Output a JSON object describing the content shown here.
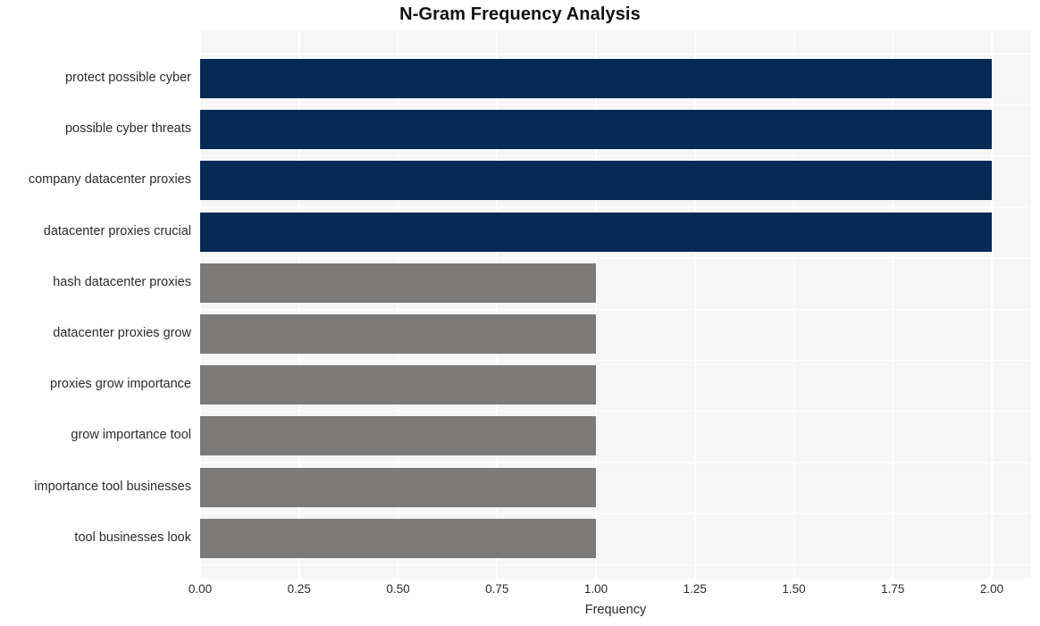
{
  "chart_data": {
    "type": "bar",
    "orientation": "horizontal",
    "title": "N-Gram Frequency Analysis",
    "xlabel": "Frequency",
    "ylabel": "",
    "xlim": [
      0.0,
      2.0
    ],
    "grid": true,
    "legend": null,
    "xticks": [
      "0.00",
      "0.25",
      "0.50",
      "0.75",
      "1.00",
      "1.25",
      "1.50",
      "1.75",
      "2.00"
    ],
    "xtick_values": [
      0.0,
      0.25,
      0.5,
      0.75,
      1.0,
      1.25,
      1.5,
      1.75,
      2.0
    ],
    "categories": [
      "protect possible cyber",
      "possible cyber threats",
      "company datacenter proxies",
      "datacenter proxies crucial",
      "hash datacenter proxies",
      "datacenter proxies grow",
      "proxies grow importance",
      "grow importance tool",
      "importance tool businesses",
      "tool businesses look"
    ],
    "values": [
      2,
      2,
      2,
      2,
      1,
      1,
      1,
      1,
      1,
      1
    ],
    "bar_colors": [
      "#042a55",
      "#042a55",
      "#042a55",
      "#042a55",
      "#7b7a78",
      "#7b7a78",
      "#7b7a78",
      "#7b7a78",
      "#7b7a78",
      "#7b7a78"
    ]
  },
  "colors": {
    "highlight": "#042a55",
    "normal": "#7b7a78",
    "plot_background": "#f6f6f6",
    "gridline": "#ffffff",
    "page_background": "#ffffff",
    "text": "#2b2b2b",
    "title_text": "#111111"
  }
}
